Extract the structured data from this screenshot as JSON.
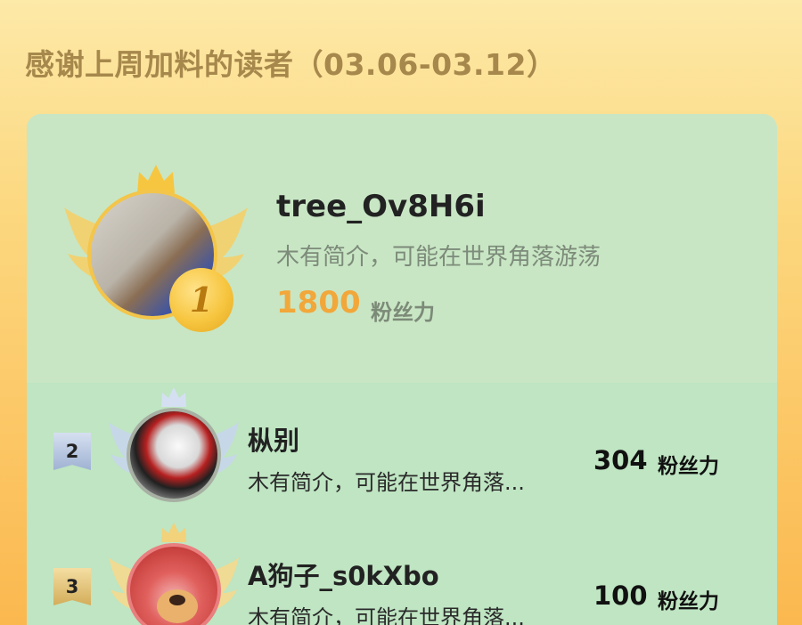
{
  "page": {
    "title": "感谢上周加料的读者（03.06-03.12）"
  },
  "colors": {
    "title": "#a6884c",
    "card_bg": "#c9e8c4",
    "first_score": "#f2a73a",
    "medal_gold": "#f7c640"
  },
  "first_place": {
    "name": "tree_Ov8H6i",
    "bio": "木有简介，可能在世界角落游荡",
    "score": "1800",
    "unit": "粉丝力",
    "medal_number": "1",
    "icons": [
      "crown-icon",
      "wing-icon",
      "medal-icon"
    ]
  },
  "rankings": [
    {
      "rank": "2",
      "name": "枞别",
      "bio": "木有简介，可能在世界角落...",
      "score": "304",
      "unit": "粉丝力"
    },
    {
      "rank": "3",
      "name": "A狗子_s0kXbo",
      "bio": "木有简介，可能在世界角落...",
      "score": "100",
      "unit": "粉丝力"
    }
  ]
}
